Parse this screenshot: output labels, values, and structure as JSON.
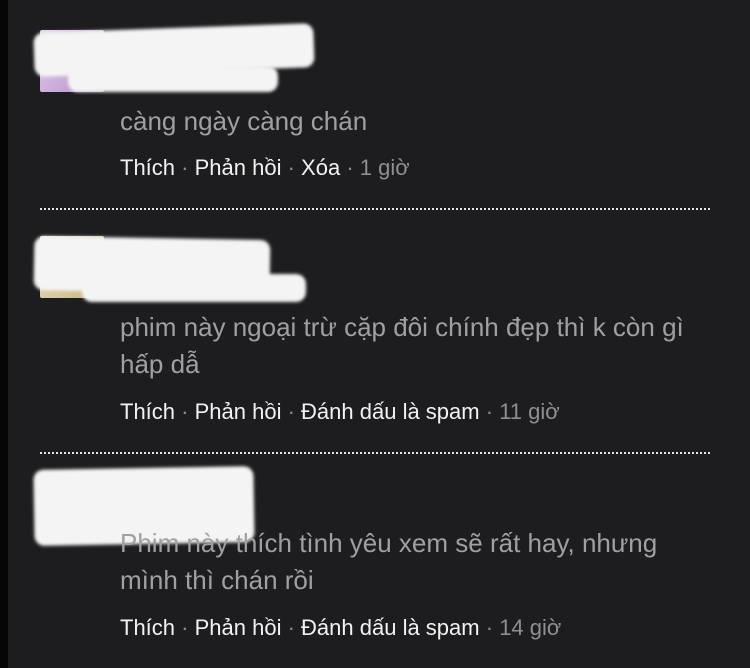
{
  "comments": [
    {
      "author_name": "",
      "author_meta": "",
      "text": "càng ngày càng chán",
      "actions": {
        "like": "Thích",
        "reply": "Phản hồi",
        "extra": "Xóa",
        "time": "1 giờ"
      },
      "avatar_color": "#c9a7d8"
    },
    {
      "author_name": "",
      "author_meta": "",
      "text": "phim này ngoại trừ cặp đôi chính đẹp thì k còn gì hấp dẫ",
      "actions": {
        "like": "Thích",
        "reply": "Phản hồi",
        "extra": "Đánh dấu là spam",
        "time": "11 giờ"
      },
      "avatar_color": "#c8b37a"
    },
    {
      "author_name": "",
      "author_meta": "",
      "text": "Phim này thích tình yêu xem sẽ rất hay, nhưng mình thì chán rồi",
      "actions": {
        "like": "Thích",
        "reply": "Phản hồi",
        "extra": "Đánh dấu là spam",
        "time": "14 giờ"
      },
      "avatar_color": "#e8e8e8"
    }
  ],
  "separator": "·",
  "colors": {
    "background": "#1d1d1f",
    "comment_text": "#a0a0a4",
    "action_text": "#f2f2f2",
    "meta_text": "#8e8e93"
  }
}
